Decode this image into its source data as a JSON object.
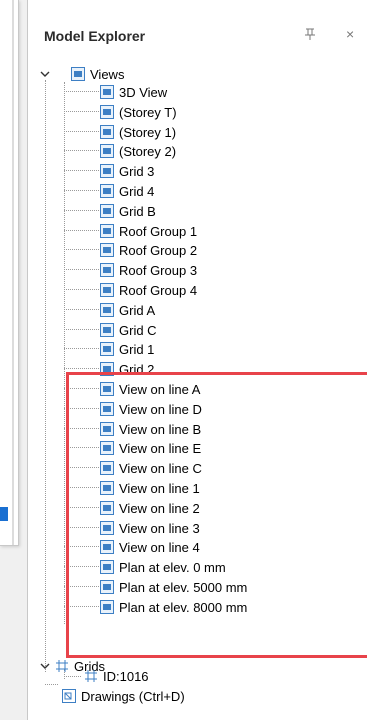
{
  "panel": {
    "title": "Model Explorer",
    "pin_icon": "pin-icon",
    "close_icon": "close-icon",
    "close_glyph": "×"
  },
  "tree": {
    "views": {
      "label": "Views",
      "items": [
        "3D View",
        "(Storey T)",
        "(Storey 1)",
        "(Storey 2)",
        "Grid 3",
        "Grid 4",
        "Grid B",
        "Roof Group 1",
        "Roof Group 2",
        "Roof Group 3",
        "Roof Group 4",
        "Grid A",
        "Grid C",
        "Grid 1",
        "Grid 2",
        "View on line A",
        "View on line D",
        "View on line B",
        "View on line E",
        "View on line C",
        "View on line 1",
        "View on line 2",
        "View on line 3",
        "View on line 4",
        "Plan at elev. 0 mm",
        "Plan at elev. 5000 mm",
        "Plan at elev. 8000 mm"
      ]
    },
    "grids": {
      "label": "Grids",
      "items": [
        "ID:1016"
      ]
    },
    "drawings": {
      "label": "Drawings (Ctrl+D)"
    }
  },
  "colors": {
    "highlight": "#e8434a",
    "view_icon": "#3d7fc4",
    "selection": "#1a6fd1"
  }
}
